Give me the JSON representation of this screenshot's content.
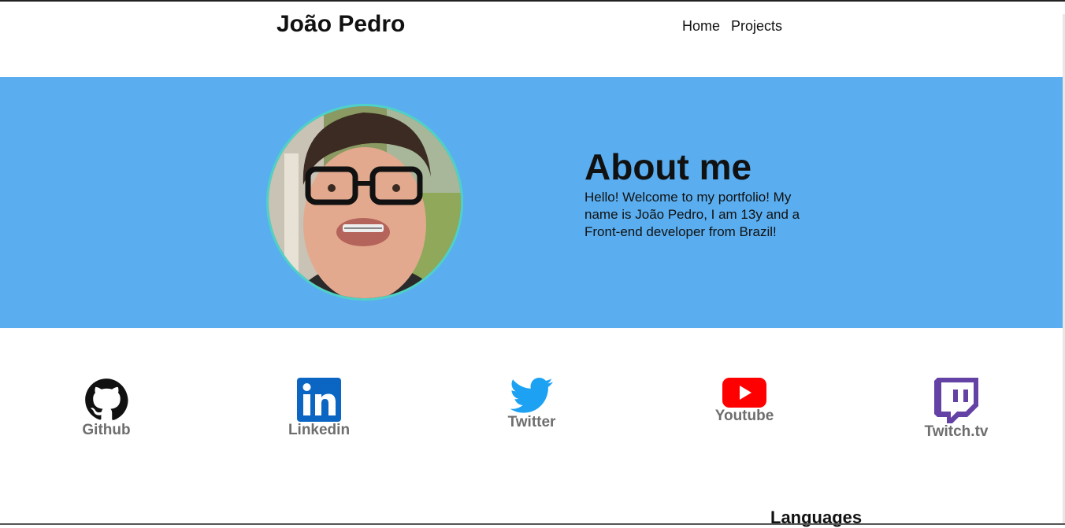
{
  "header": {
    "brand": "João Pedro",
    "nav": [
      {
        "label": "Home"
      },
      {
        "label": "Projects"
      }
    ]
  },
  "hero": {
    "background_color": "#5aaef0",
    "avatar_border_color": "#4fd1c5",
    "title": "About me",
    "description": "Hello! Welcome to my portfolio! My name is João Pedro, I am 13y and a Front-end developer from Brazil!"
  },
  "social": [
    {
      "label": "Github",
      "icon": "github-icon",
      "color": "#111111"
    },
    {
      "label": "Linkedin",
      "icon": "linkedin-icon",
      "color": "#0a66c2"
    },
    {
      "label": "Twitter",
      "icon": "twitter-icon",
      "color": "#1da1f2"
    },
    {
      "label": "Youtube",
      "icon": "youtube-icon",
      "color": "#ff0000"
    },
    {
      "label": "Twitch.tv",
      "icon": "twitch-icon",
      "color": "#6441a5"
    }
  ],
  "languages": {
    "title": "Languages"
  }
}
